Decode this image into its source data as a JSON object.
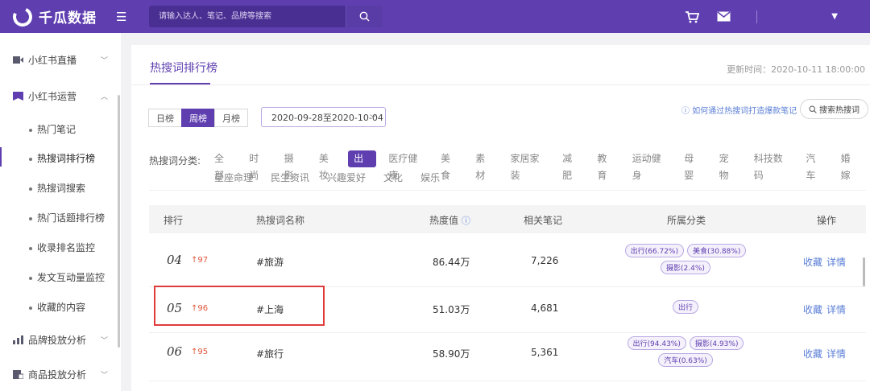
{
  "app": {
    "logo_text": "千瓜数据"
  },
  "search": {
    "placeholder": "请输入达人、笔记、品牌等搜索"
  },
  "sidebar": {
    "groups": [
      {
        "label": "小红书直播"
      },
      {
        "label": "小红书运营"
      },
      {
        "label": "品牌投放分析"
      },
      {
        "label": "商品投放分析"
      }
    ],
    "items": [
      {
        "label": "热门笔记"
      },
      {
        "label": "热搜词排行榜"
      },
      {
        "label": "热搜词搜索"
      },
      {
        "label": "热门话题排行榜"
      },
      {
        "label": "收录排名监控"
      },
      {
        "label": "发文互动量监控"
      },
      {
        "label": "收藏的内容"
      }
    ]
  },
  "main": {
    "title": "热搜词排行榜",
    "update_time": "更新时间：2020-10-11 18:00:00",
    "period_tabs": [
      "日榜",
      "周榜",
      "月榜"
    ],
    "date_range": "2020-09-28至2020-10-04",
    "help_link": "如何通过热搜词打造爆款笔记",
    "search_hot_button": "搜索热搜词",
    "category_label": "热搜词分类:",
    "categories_row1": [
      "全部",
      "时尚",
      "摄影",
      "美妆",
      "出行",
      "医疗健康",
      "美食",
      "素材",
      "家居家装",
      "减肥",
      "教育",
      "运动健身",
      "母婴",
      "宠物",
      "科技数码",
      "汽车",
      "婚嫁"
    ],
    "categories_row2": [
      "星座命理",
      "民生资讯",
      "兴趣爱好",
      "文化",
      "娱乐"
    ]
  },
  "table": {
    "headers": [
      "排行",
      "热搜词名称",
      "热度值",
      "相关笔记",
      "所属分类",
      "操作"
    ],
    "rows": [
      {
        "rank": "04",
        "trend": "↑97",
        "keyword": "#旅游",
        "heat": "86.44万",
        "notes": "7,226",
        "tags": [
          "出行(66.72%)",
          "美食(30.88%)",
          "摄影(2.4%)"
        ],
        "op1": "收藏",
        "op2": "详情"
      },
      {
        "rank": "05",
        "trend": "↑96",
        "keyword": "#上海",
        "heat": "51.03万",
        "notes": "4,681",
        "tags": [
          "出行"
        ],
        "op1": "收藏",
        "op2": "详情"
      },
      {
        "rank": "06",
        "trend": "↑95",
        "keyword": "#旅行",
        "heat": "58.90万",
        "notes": "5,361",
        "tags": [
          "出行(94.43%)",
          "摄影(4.93%)",
          "汽车(0.63%)"
        ],
        "op1": "收藏",
        "op2": "详情"
      }
    ]
  },
  "colors": {
    "brand": "#5f3fb0",
    "link": "#5b7fd6",
    "trend_up": "#e0553a",
    "highlight": "#e03b3b"
  }
}
